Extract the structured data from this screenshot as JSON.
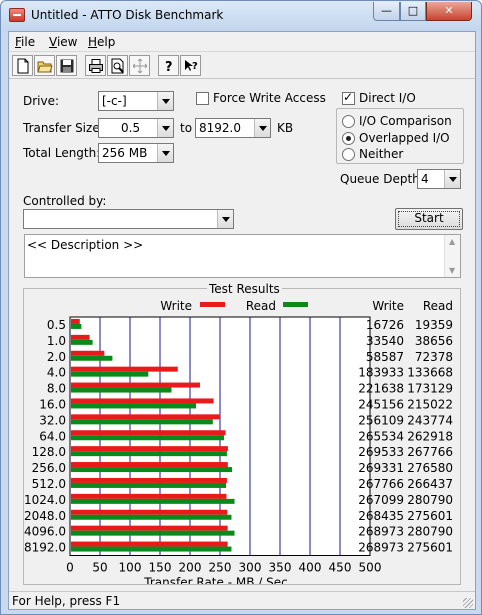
{
  "window": {
    "title": "Untitled - ATTO Disk Benchmark"
  },
  "menu": [
    {
      "label": "File",
      "accel": "F"
    },
    {
      "label": "View",
      "accel": "V"
    },
    {
      "label": "Help",
      "accel": "H"
    }
  ],
  "toolbar": [
    "new-file-icon",
    "open-folder-icon",
    "save-icon",
    "print-icon",
    "print-preview-icon",
    "move-icon",
    "help-icon",
    "context-help-icon"
  ],
  "settings": {
    "drive_label": "Drive:",
    "drive_value": "[-c-]",
    "force_write_label": "Force Write Access",
    "force_write_checked": false,
    "direct_io_label": "Direct I/O",
    "direct_io_checked": true,
    "transfer_size_label": "Transfer Size:",
    "transfer_from": "0.5",
    "to_label": "to",
    "transfer_to": "8192.0",
    "kb_label": "KB",
    "total_length_label": "Total Length:",
    "total_length_value": "256 MB",
    "io_options": [
      {
        "label": "I/O Comparison",
        "selected": false
      },
      {
        "label": "Overlapped I/O",
        "selected": true
      },
      {
        "label": "Neither",
        "selected": false
      }
    ],
    "queue_depth_label": "Queue Depth:",
    "queue_depth_value": "4",
    "controlled_by_label": "Controlled by:",
    "controlled_by_value": "",
    "start_label": "Start",
    "description": "<< Description >>"
  },
  "results": {
    "title": "Test Results",
    "legend_write": "Write",
    "legend_read": "Read",
    "col_write": "Write",
    "col_read": "Read",
    "xlabel": "Transfer Rate - MB / Sec",
    "colors": {
      "write": "#e81a1a",
      "read": "#0a8a1a",
      "grid": "#1a1a9a"
    }
  },
  "chart_data": {
    "type": "bar",
    "title": "Test Results",
    "orientation": "horizontal",
    "categories": [
      "0.5",
      "1.0",
      "2.0",
      "4.0",
      "8.0",
      "16.0",
      "32.0",
      "64.0",
      "128.0",
      "256.0",
      "512.0",
      "1024.0",
      "2048.0",
      "4096.0",
      "8192.0"
    ],
    "series": [
      {
        "name": "Write",
        "values": [
          16.3,
          32.7,
          57.2,
          179.6,
          216.6,
          239.4,
          250.1,
          259.3,
          263.2,
          263.0,
          261.5,
          260.8,
          262.1,
          262.7,
          262.7
        ]
      },
      {
        "name": "Read",
        "values": [
          18.9,
          37.7,
          70.7,
          130.5,
          169.1,
          210.0,
          238.0,
          256.8,
          261.5,
          270.1,
          260.2,
          274.2,
          269.1,
          274.2,
          269.1
        ]
      }
    ],
    "write_values_text": [
      "16726",
      "33540",
      "58587",
      "183933",
      "221638",
      "245156",
      "256109",
      "265534",
      "269533",
      "269331",
      "267766",
      "267099",
      "268435",
      "268973",
      "268973"
    ],
    "read_values_text": [
      "19359",
      "38656",
      "72378",
      "133668",
      "173129",
      "215022",
      "243774",
      "262918",
      "267766",
      "276580",
      "266437",
      "280790",
      "275601",
      "280790",
      "275601"
    ],
    "xlabel": "Transfer Rate - MB / Sec",
    "xticks": [
      "0",
      "50",
      "100",
      "150",
      "200",
      "250",
      "300",
      "350",
      "400",
      "450",
      "500"
    ],
    "xlim": [
      0,
      500
    ],
    "grid": true,
    "legend": "top"
  },
  "status": {
    "text": "For Help, press F1"
  }
}
